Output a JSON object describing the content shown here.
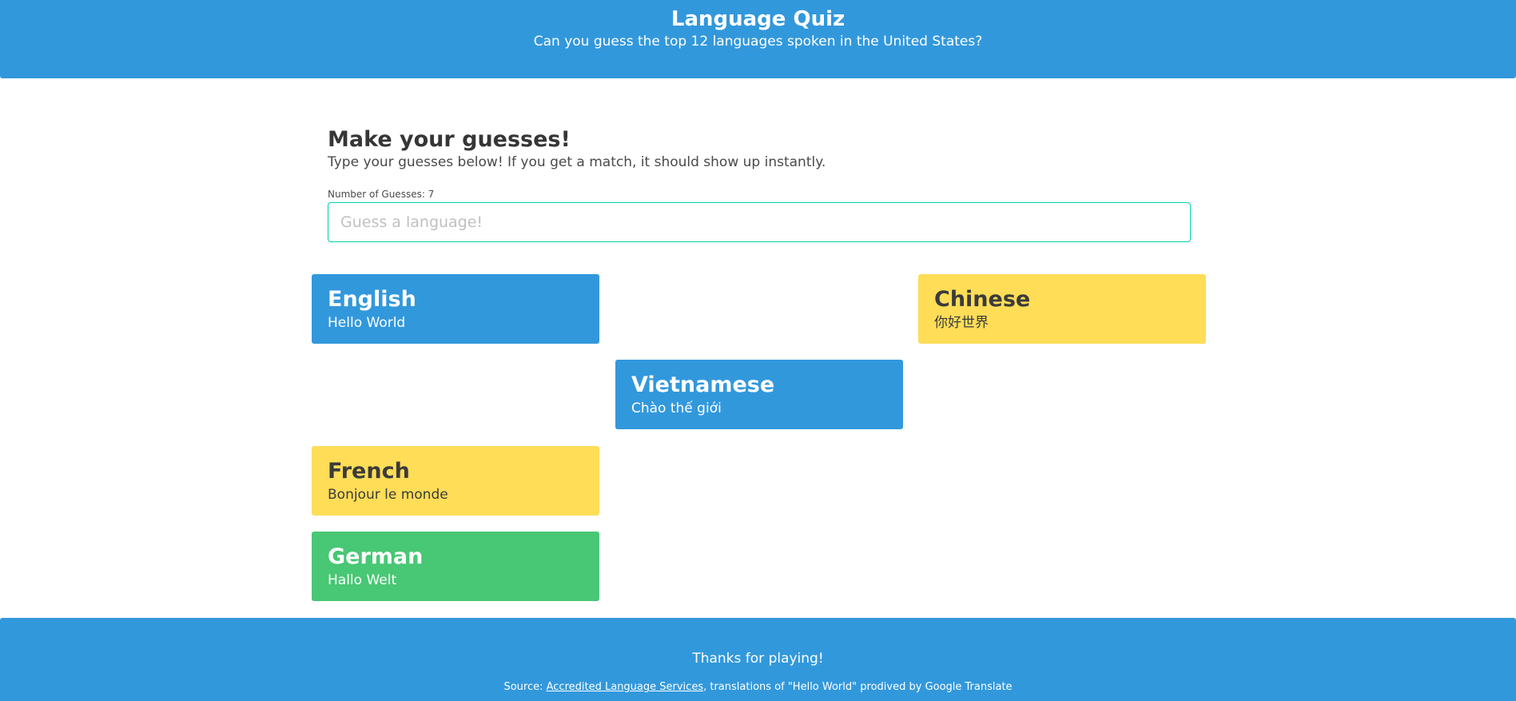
{
  "header": {
    "title": "Language Quiz",
    "subtitle": "Can you guess the top 12 languages spoken in the United States?"
  },
  "main": {
    "heading": "Make your guesses!",
    "description": "Type your guesses below! If you get a match, it should show up instantly.",
    "guess_count_label": "Number of Guesses: 7",
    "input_placeholder": "Guess a language!",
    "input_value": ""
  },
  "cards": {
    "english": {
      "name": "English",
      "hello": "Hello World",
      "color": "#3298dc"
    },
    "chinese": {
      "name": "Chinese",
      "hello": "你好世界",
      "color": "#ffdd57"
    },
    "vietnamese": {
      "name": "Vietnamese",
      "hello": "Chào thế giới",
      "color": "#3298dc"
    },
    "french": {
      "name": "French",
      "hello": "Bonjour le monde",
      "color": "#ffdd57"
    },
    "german": {
      "name": "German",
      "hello": "Hallo Welt",
      "color": "#48c774"
    }
  },
  "footer": {
    "thanks": "Thanks for playing!",
    "source_prefix": "Source: ",
    "source_link": "Accredited Language Services",
    "source_suffix": ", translations of \"Hello World\" prodived by Google Translate"
  },
  "colors": {
    "primary": "#3298dc",
    "accent_input_border": "#00d1b2",
    "warning": "#ffdd57",
    "success": "#48c774"
  }
}
